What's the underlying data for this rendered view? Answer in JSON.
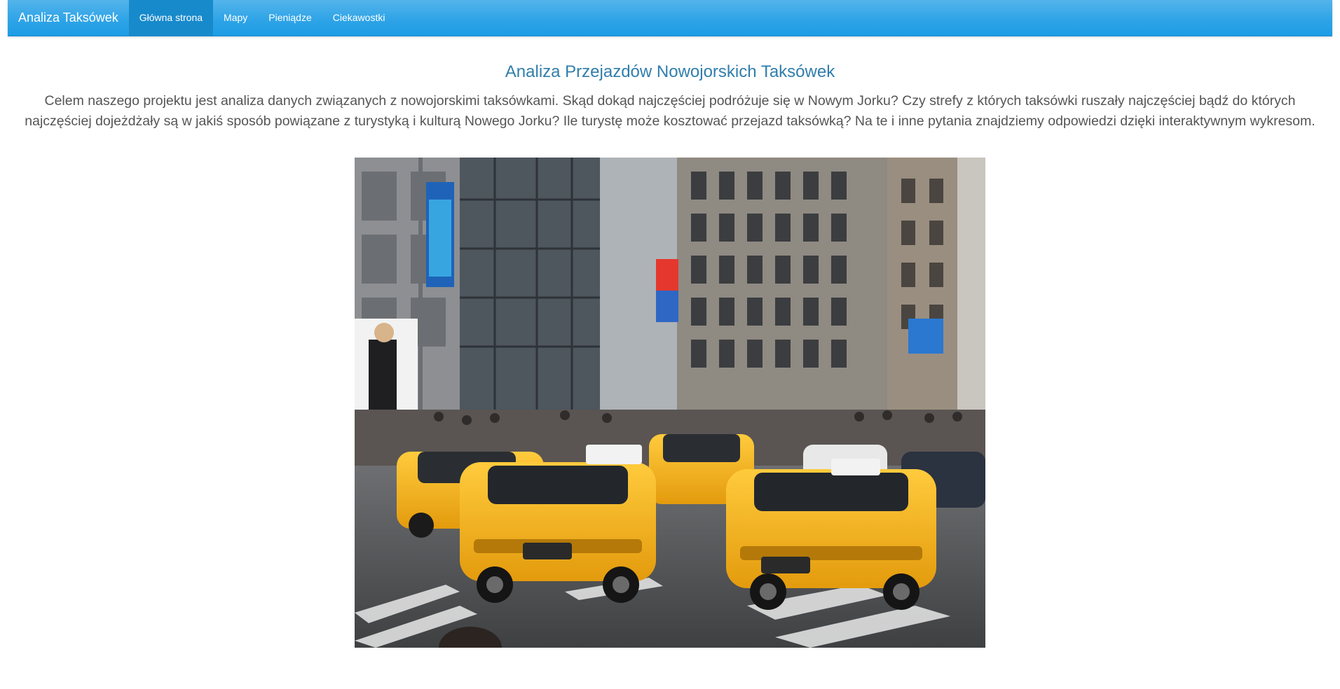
{
  "navbar": {
    "brand": "Analiza Taksówek",
    "items": [
      {
        "label": "Główna strona",
        "active": true
      },
      {
        "label": "Mapy",
        "active": false
      },
      {
        "label": "Pieniądze",
        "active": false
      },
      {
        "label": "Ciekawostki",
        "active": false
      }
    ]
  },
  "main": {
    "title": "Analiza Przejazdów Nowojorskich Taksówek",
    "intro": "Celem naszego projektu jest analiza danych związanych z nowojorskimi taksówkami. Skąd dokąd najczęściej podróżuje się w Nowym Jorku? Czy strefy z których taksówki ruszały najczęściej bądź do których najczęściej dojeżdżały są w jakiś sposób powiązane z turystyką i kulturą Nowego Jorku? Ile turystę może kosztować przejazd taksówką? Na te i inne pytania znajdziemy odpowiedzi dzięki interaktywnym wykresom."
  },
  "colors": {
    "navbar": "#2fa4e7",
    "navbar_active": "#178acc",
    "title": "#317eac",
    "text": "#555555",
    "taxi_yellow": "#f5b41c"
  }
}
